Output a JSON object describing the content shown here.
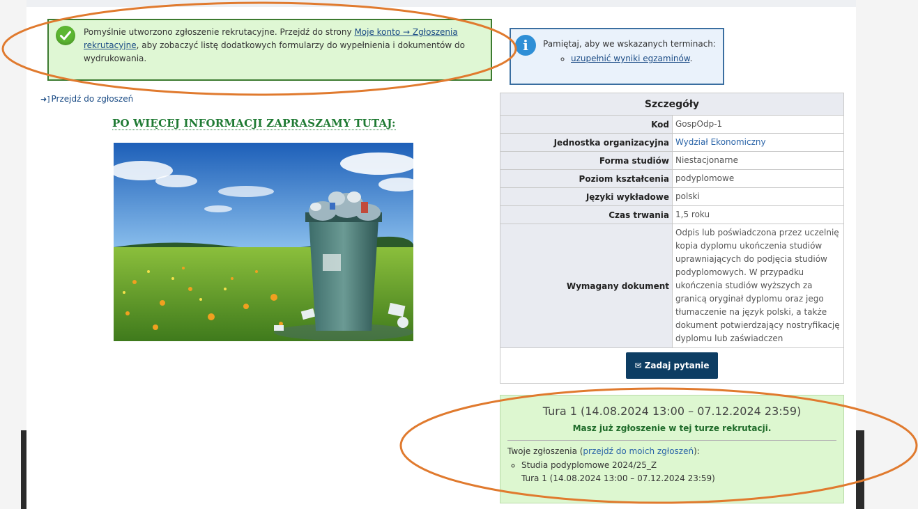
{
  "success_alert": {
    "text_before": "Pomyślnie utworzono zgłoszenie rekrutacyjne. Przejdź do strony ",
    "link": "Moje konto → Zgłoszenia rekrutacyjne",
    "text_after": ", aby zobaczyć listę dodatkowych formularzy do wypełnienia i dokumentów do wydrukowania."
  },
  "info_alert": {
    "text": "Pamiętaj, aby we wskazanych terminach:",
    "item_link": "uzupełnić wyniki egzaminów",
    "item_suffix": "."
  },
  "back_link": "Przejdź do zgłoszeń",
  "promo_heading": "PO WIĘCEJ INFORMACJI ZAPRASZAMY TUTAJ:",
  "details": {
    "title": "Szczegóły",
    "rows": [
      {
        "label": "Kod",
        "value": "GospOdp-1"
      },
      {
        "label": "Jednostka organizacyjna",
        "value": "Wydział Ekonomiczny"
      },
      {
        "label": "Forma studiów",
        "value": "Niestacjonarne"
      },
      {
        "label": "Poziom kształcenia",
        "value": "podyplomowe"
      },
      {
        "label": "Języki wykładowe",
        "value": "polski"
      },
      {
        "label": "Czas trwania",
        "value": "1,5 roku"
      },
      {
        "label": "Wymagany dokument",
        "value": "Odpis lub poświadczona przez uczelnię kopia dyplomu ukończenia studiów uprawniających do podjęcia studiów podyplomowych. W przypadku ukończenia studiów wyższych za granicą oryginał dyplomu oraz jego tłumaczenie na język polski, a także dokument potwierdzający nostryfikację dyplomu lub zaświadczen"
      }
    ],
    "ask_button": "Zadaj pytanie"
  },
  "round": {
    "title": "Tura 1 (14.08.2024 13:00 – 07.12.2024 23:59)",
    "message": "Masz już zgłoszenie w tej turze rekrutacji.",
    "applications_prefix": "Twoje zgłoszenia (",
    "applications_link": "przejdź do moich zgłoszeń",
    "applications_suffix": "):",
    "items": [
      {
        "line1": "Studia podyplomowe 2024/25_Z",
        "line2": "Tura 1 (14.08.2024 13:00 – 07.12.2024 23:59)"
      }
    ]
  },
  "colors": {
    "success_bg": "#dff7d4",
    "info_bg": "#eaf2fb",
    "button_bg": "#0d3d63",
    "annotation": "#e07a2e",
    "heading_green": "#1f7a33"
  },
  "icons": [
    "check-icon",
    "info-icon",
    "sign-in-icon",
    "envelope-icon"
  ]
}
